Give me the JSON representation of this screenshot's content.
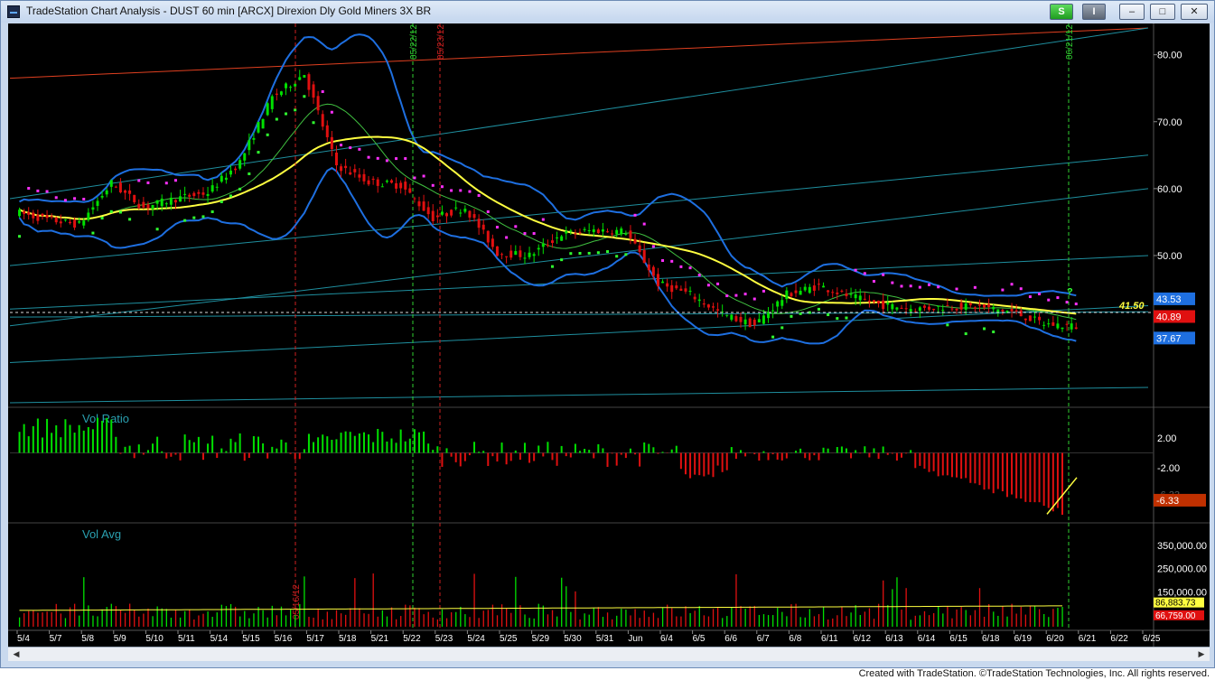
{
  "window": {
    "title": "TradeStation Chart Analysis - DUST 60 min [ARCX] Direxion Dly Gold Miners 3X BR",
    "status_label": "S",
    "info_label": "I",
    "min_label": "–",
    "max_label": "□",
    "close_label": "✕",
    "scroll_left": "◀",
    "scroll_right": "▶"
  },
  "footer": "Created with TradeStation. ©TradeStation Technologies, Inc. All rights reserved.",
  "colors": {
    "background": "#000000",
    "grid": "#2a2a2a",
    "price_up": "#00e000",
    "price_down": "#e01010",
    "bollinger": "#1e6fe0",
    "ma_yellow": "#ffff40",
    "ma_green": "#40c040",
    "stop_magenta": "#ff30ff",
    "stop_green": "#30ff30",
    "trend_cyan": "#1f8f9f",
    "trend_orange": "#e04020",
    "vline_green": "#30d030",
    "vline_red": "#d02020",
    "label_teal": "#2aa0b0"
  },
  "chart_data": [
    {
      "type": "candlestick",
      "name": "DUST 60 min",
      "interval": "60 min",
      "x_labels": [
        "5/4",
        "5/7",
        "5/8",
        "5/9",
        "5/10",
        "5/11",
        "5/14",
        "5/15",
        "5/16",
        "5/17",
        "5/18",
        "5/21",
        "5/22",
        "5/23",
        "5/24",
        "5/25",
        "5/29",
        "5/30",
        "5/31",
        "Jun",
        "6/4",
        "6/5",
        "6/6",
        "6/7",
        "6/8",
        "6/11",
        "6/12",
        "6/13",
        "6/14",
        "6/15",
        "6/18",
        "6/19",
        "6/20",
        "6/21",
        "6/22",
        "6/25"
      ],
      "y_ticks": [
        "80.00",
        "70.00",
        "60.00",
        "50.00"
      ],
      "ylim": [
        28,
        84
      ],
      "daily_closes": [
        55.4,
        54.6,
        60.8,
        57.2,
        58.5,
        59.4,
        64.0,
        73.6,
        77.2,
        63.5,
        61.0,
        60.5,
        55.6,
        57.2,
        50.4,
        50.0,
        53.2,
        53.8,
        53.6,
        45.8,
        44.2,
        41.2,
        39.6,
        44.2,
        45.5,
        43.8,
        42.6,
        42.0,
        42.4,
        42.3,
        41.6,
        39.8,
        39.4
      ],
      "price_labels": [
        {
          "text": "43.53",
          "value": 43.53,
          "color": "#1e6fe0"
        },
        {
          "text": "40.89",
          "value": 40.89,
          "color": "#e01010"
        },
        {
          "text": "37.67",
          "value": 37.67,
          "color": "#1e6fe0"
        }
      ],
      "level_line": {
        "value": 41.5,
        "text": "41.50"
      },
      "annotation_question": "?",
      "vline_labels": [
        "05/22/12",
        "05/23/12",
        "06/21/12"
      ]
    },
    {
      "type": "bar",
      "name": "Vol Ratio",
      "y_ticks": [
        "2.00",
        "-2.00"
      ],
      "ylim": [
        -9,
        5.5
      ],
      "last_value_label": "-6.33",
      "hidden_label": "-6.33"
    },
    {
      "type": "bar",
      "name": "Vol Avg",
      "y_ticks": [
        "350,000.00",
        "250,000.00",
        "150,000.00"
      ],
      "ylim": [
        0,
        420000
      ],
      "last_value_labels": [
        "86,883.73",
        "66,759.00"
      ]
    }
  ],
  "vline_dates": {
    "red_vline_bottom_label": "05/16/12"
  }
}
